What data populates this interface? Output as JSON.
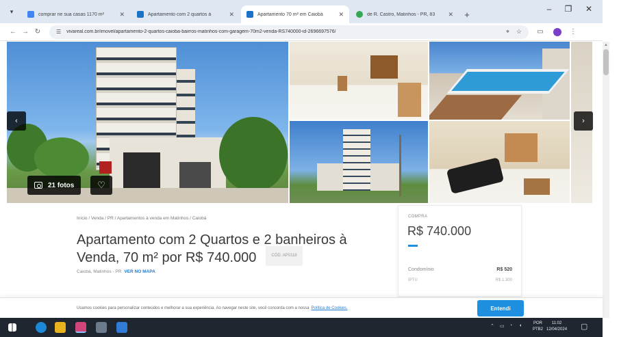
{
  "browser": {
    "tabs": [
      {
        "title": "comprar ne sua casas 1170 m²",
        "favicon_color": "#4285f4",
        "active": false
      },
      {
        "title": "Apartamento com 2 quartos à",
        "favicon_color": "#1a73c8",
        "active": false
      },
      {
        "title": "Apartamento 70 m² em Caiobá",
        "favicon_color": "#1a73c8",
        "active": true
      },
      {
        "title": "de R. Castro, Matinhos - PR, 83",
        "favicon_color": "#34a853",
        "active": false
      }
    ],
    "new_tab_icon": "plus-icon",
    "window_controls": {
      "minimize": "–",
      "maximize": "❐",
      "close": "✕"
    },
    "url": "vivareal.com.br/imovel/apartamento-2-quartos-caioba-bairros-matinhos-com-garagem-70m2-venda-RS740000-id-2696697576/",
    "nav": {
      "back": "←",
      "forward": "→",
      "reload": "↻"
    }
  },
  "gallery": {
    "photos_count_label": "21 fotos",
    "prev_arrow": "‹",
    "next_arrow": "›"
  },
  "listing": {
    "breadcrumb": "Início / Venda / PR / Apartamentos à venda em Matinhos / Caiobá",
    "title": "Apartamento com 2 Quartos e 2 banheiros à Venda, 70 m² por R$ 740.000",
    "code": "CÓD. AP0118",
    "location": "Caiobá, Matinhos - PR",
    "map_link": "VER NO MAPA"
  },
  "price_card": {
    "label": "COMPRA",
    "price": "R$ 740.000",
    "rows": [
      {
        "key": "Condomínio",
        "value": "R$ 520"
      },
      {
        "key": "IPTU",
        "value": "R$ 1.300"
      }
    ]
  },
  "cookie": {
    "text": "Usamos cookies para personalizar conteúdos e melhorar a sua experiência. Ao navegar neste site, você concorda com a nossa",
    "link": "Política de Cookies.",
    "button": "Entendi"
  },
  "taskbar": {
    "lang": [
      "POR",
      "PTB2"
    ],
    "time": "11:02",
    "date": "12/04/2024"
  },
  "colors": {
    "accent": "#1f8fe0",
    "link": "#1f7ad1",
    "taskbar": "#1f2630"
  }
}
